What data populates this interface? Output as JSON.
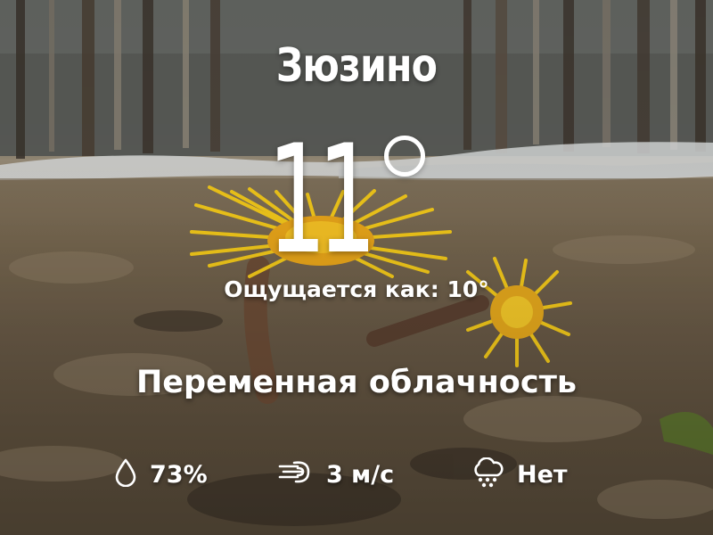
{
  "location": {
    "name": "Зюзино"
  },
  "current": {
    "temperature": "11",
    "feels_like_label": "Ощущается как:",
    "feels_like_value": "10°",
    "condition": "Переменная облачность"
  },
  "stats": {
    "humidity": {
      "icon": "droplet-icon",
      "value": "73%"
    },
    "wind": {
      "icon": "wind-icon",
      "value": "3 м/с"
    },
    "precipitation": {
      "icon": "rain-cloud-icon",
      "value": "Нет"
    }
  },
  "colors": {
    "text": "#ffffff",
    "flower": "#f2c81a"
  }
}
